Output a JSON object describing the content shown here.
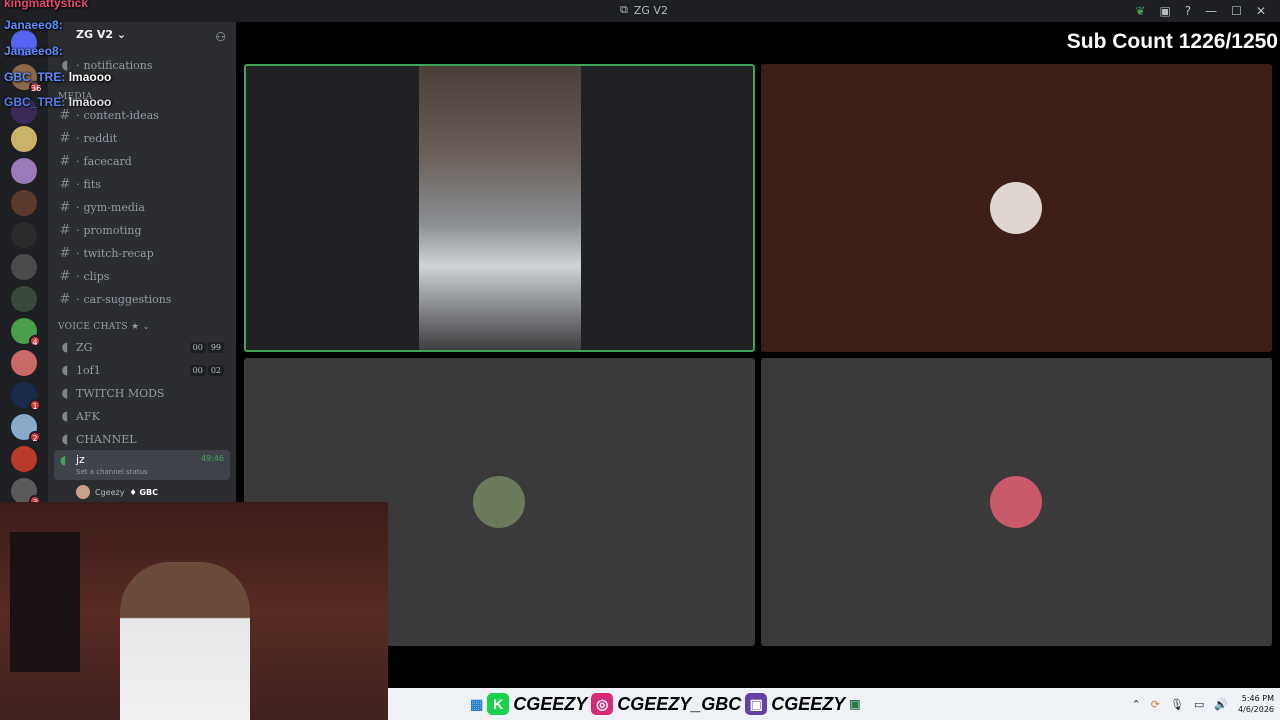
{
  "window": {
    "title": "ZG V2"
  },
  "overlay": {
    "sub_count": "Sub Count 1226/1250"
  },
  "server": {
    "name": "ZG V2"
  },
  "chat": [
    {
      "user": "kingmattystick",
      "msg": ""
    },
    {
      "user": "Janaeeo8:",
      "msg": ""
    },
    {
      "user": "Janaeeo8:",
      "msg": ""
    },
    {
      "user": "GBC_TRE:",
      "msg": "lmaooo"
    },
    {
      "user": "GBC_TRE:",
      "msg": "lmaooo"
    }
  ],
  "channels": {
    "text": [
      {
        "name": "notifications"
      },
      {
        "name": "content-ideas"
      },
      {
        "name": "reddit"
      },
      {
        "name": "facecard"
      },
      {
        "name": "fits"
      },
      {
        "name": "gym-media"
      },
      {
        "name": "promoting"
      },
      {
        "name": "twitch-recap"
      },
      {
        "name": "clips"
      },
      {
        "name": "car-suggestions"
      }
    ],
    "media_category": "MEDIA",
    "voice_category": "VOICE CHATS ★",
    "voice": [
      {
        "name": "ZG",
        "c1": "00",
        "c2": "99"
      },
      {
        "name": "1of1",
        "c1": "00",
        "c2": "02"
      },
      {
        "name": "TWITCH MODS"
      },
      {
        "name": "AFK"
      },
      {
        "name": "CHANNEL"
      }
    ],
    "active": {
      "name": "jz",
      "time": "49:46",
      "status": "Set a channel status",
      "member": "Cgeezy",
      "tag": "GBC"
    }
  },
  "server_badges": [
    "36",
    "4",
    "1",
    "2",
    "3"
  ],
  "socials": {
    "kick": "CGEEZY",
    "instagram": "CGEEZY_GBC",
    "twitch": "CGEEZY"
  },
  "tray": {
    "time": "5:46 PM",
    "date": "4/6/2026"
  },
  "colors": {
    "accent_green": "#43a25a",
    "tile_brown": "#3a1e17",
    "tile_gray": "#3a3a3a"
  }
}
